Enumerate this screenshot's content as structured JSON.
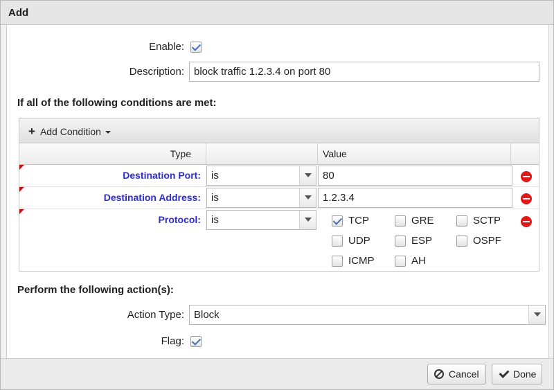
{
  "window": {
    "title": "Add"
  },
  "form": {
    "enable_label": "Enable:",
    "enable_checked": true,
    "description_label": "Description:",
    "description_value": "block traffic 1.2.3.4 on port 80"
  },
  "conditions": {
    "section_title": "If all of the following conditions are met:",
    "add_condition_label": "Add Condition",
    "columns": {
      "type": "Type",
      "op": "",
      "value": "Value"
    },
    "rows": [
      {
        "type": "Destination Port:",
        "operator": "is",
        "value": "80"
      },
      {
        "type": "Destination Address:",
        "operator": "is",
        "value": "1.2.3.4"
      },
      {
        "type": "Protocol:",
        "operator": "is"
      }
    ],
    "protocols": [
      {
        "label": "TCP",
        "checked": true
      },
      {
        "label": "GRE",
        "checked": false
      },
      {
        "label": "SCTP",
        "checked": false
      },
      {
        "label": "UDP",
        "checked": false
      },
      {
        "label": "ESP",
        "checked": false
      },
      {
        "label": "OSPF",
        "checked": false
      },
      {
        "label": "ICMP",
        "checked": false
      },
      {
        "label": "AH",
        "checked": false
      }
    ]
  },
  "actions": {
    "section_title": "Perform the following action(s):",
    "action_type_label": "Action Type:",
    "action_type_value": "Block",
    "flag_label": "Flag:",
    "flag_checked": true
  },
  "footer": {
    "cancel_label": "Cancel",
    "done_label": "Done"
  },
  "colors": {
    "condition_type_text": "#2b2bd1",
    "remove_icon": "#e01818",
    "dirty_marker": "#c01313"
  }
}
